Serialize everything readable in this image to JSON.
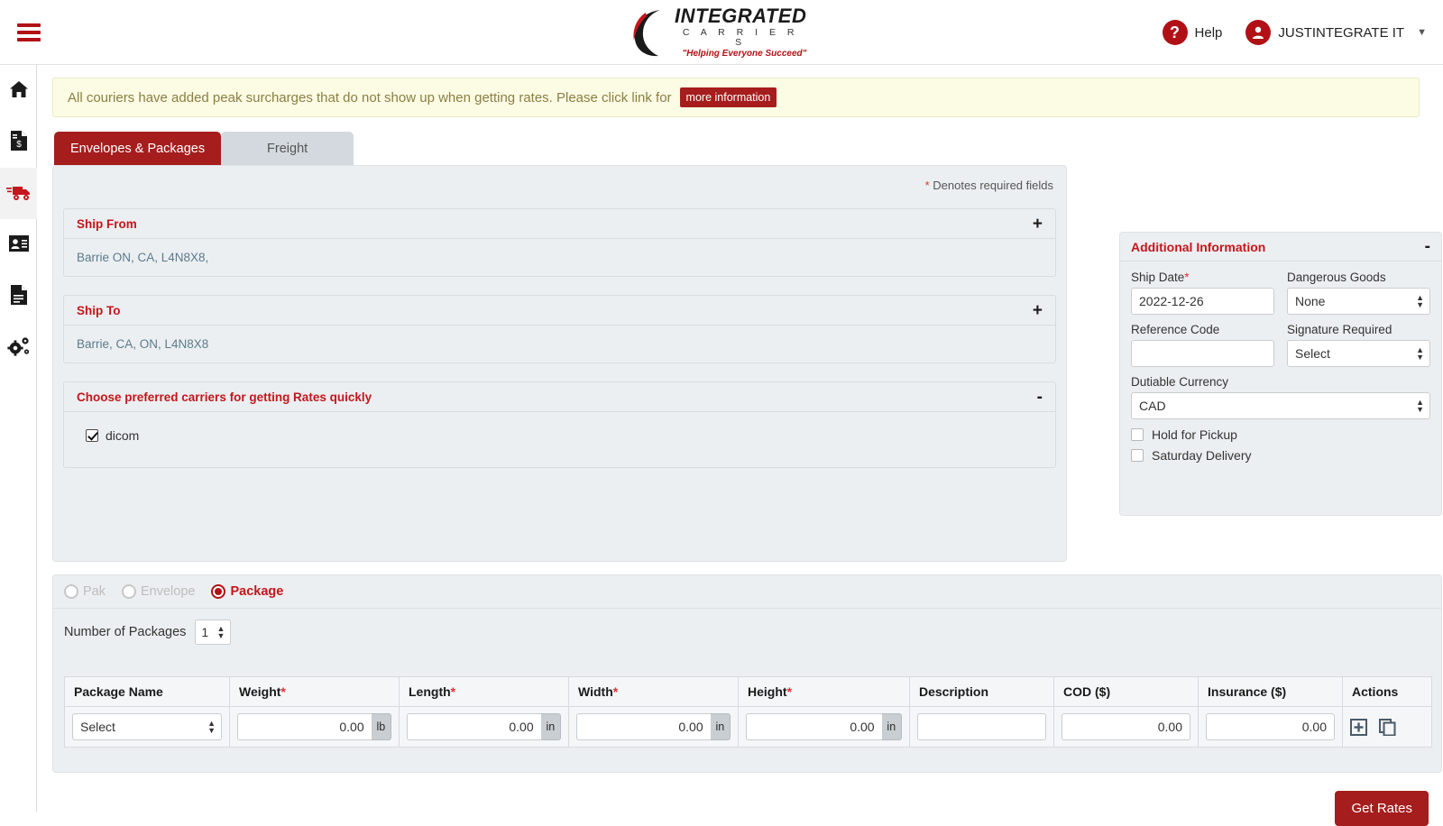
{
  "brand": {
    "logo_title": "INTEGRATED",
    "logo_subtitle": "C A R R I E R S",
    "logo_tagline": "\"Helping Everyone Succeed\"",
    "accent_red": "#b11116",
    "dark_red": "#a51d1d"
  },
  "topbar": {
    "menu_icon": "hamburger-icon",
    "help_label": "Help",
    "help_icon": "question-circle-icon",
    "user_name": "JUSTINTEGRATE IT",
    "user_icon": "user-circle-icon",
    "caret_icon": "chevron-down-icon"
  },
  "sidebar": {
    "items": [
      {
        "name": "home",
        "icon": "home-icon",
        "active": false
      },
      {
        "name": "billing",
        "icon": "invoice-dollar-icon",
        "active": false
      },
      {
        "name": "shipping",
        "icon": "truck-icon",
        "active": true
      },
      {
        "name": "address-book",
        "icon": "contact-card-icon",
        "active": false
      },
      {
        "name": "reports",
        "icon": "document-icon",
        "active": false
      },
      {
        "name": "settings",
        "icon": "gears-icon",
        "active": false
      }
    ]
  },
  "alert": {
    "text": "All couriers have added peak surcharges that do not show up when getting rates. Please click link for",
    "link_label": "more information"
  },
  "tabs": [
    {
      "label": "Envelopes & Packages",
      "active": true
    },
    {
      "label": "Freight",
      "active": false
    }
  ],
  "form": {
    "denotes_star": "*",
    "denotes_text": "Denotes required fields",
    "ship_from": {
      "title": "Ship From",
      "toggle": "+",
      "address": "Barrie ON, CA, L4N8X8,"
    },
    "ship_to": {
      "title": "Ship To",
      "toggle": "+",
      "address": "Barrie, CA, ON, L4N8X8"
    },
    "carriers": {
      "title": "Choose preferred carriers for getting Rates quickly",
      "toggle": "-",
      "options": [
        {
          "label": "dicom",
          "checked": true
        }
      ]
    }
  },
  "additional_information": {
    "title": "Additional Information",
    "toggle": "-",
    "ship_date": {
      "label": "Ship Date",
      "required": "*",
      "value": "2022-12-26"
    },
    "dangerous_goods": {
      "label": "Dangerous Goods",
      "value": "None",
      "options": [
        "None"
      ]
    },
    "reference_code": {
      "label": "Reference Code",
      "value": "",
      "placeholder": ""
    },
    "signature_required": {
      "label": "Signature Required",
      "value": "Select",
      "options": [
        "Select"
      ]
    },
    "dutiable_currency": {
      "label": "Dutiable Currency",
      "value": "CAD",
      "options": [
        "CAD"
      ]
    },
    "hold_for_pickup": {
      "label": "Hold for Pickup",
      "checked": false
    },
    "saturday_delivery": {
      "label": "Saturday Delivery",
      "checked": false
    }
  },
  "packages": {
    "types": [
      {
        "label": "Pak",
        "selected": false,
        "disabled": true
      },
      {
        "label": "Envelope",
        "selected": false,
        "disabled": true
      },
      {
        "label": "Package",
        "selected": true,
        "disabled": false
      }
    ],
    "number_label": "Number of Packages",
    "number_value": "1",
    "number_options": [
      "1"
    ],
    "columns": [
      {
        "label": "Package Name",
        "required": false
      },
      {
        "label": "Weight",
        "required": true
      },
      {
        "label": "Length",
        "required": true
      },
      {
        "label": "Width",
        "required": true
      },
      {
        "label": "Height",
        "required": true
      },
      {
        "label": "Description",
        "required": false
      },
      {
        "label": "COD ($)",
        "required": false
      },
      {
        "label": "Insurance ($)",
        "required": false
      },
      {
        "label": "Actions",
        "required": false
      }
    ],
    "rows": [
      {
        "package_name": "Select",
        "package_name_options": [
          "Select"
        ],
        "weight": "0.00",
        "weight_unit": "lb",
        "length": "0.00",
        "length_unit": "in",
        "width": "0.00",
        "width_unit": "in",
        "height": "0.00",
        "height_unit": "in",
        "description": "",
        "cod": "0.00",
        "insurance": "0.00",
        "actions": [
          "add-row-icon",
          "copy-row-icon"
        ]
      }
    ]
  },
  "footer": {
    "get_rates_label": "Get Rates"
  }
}
